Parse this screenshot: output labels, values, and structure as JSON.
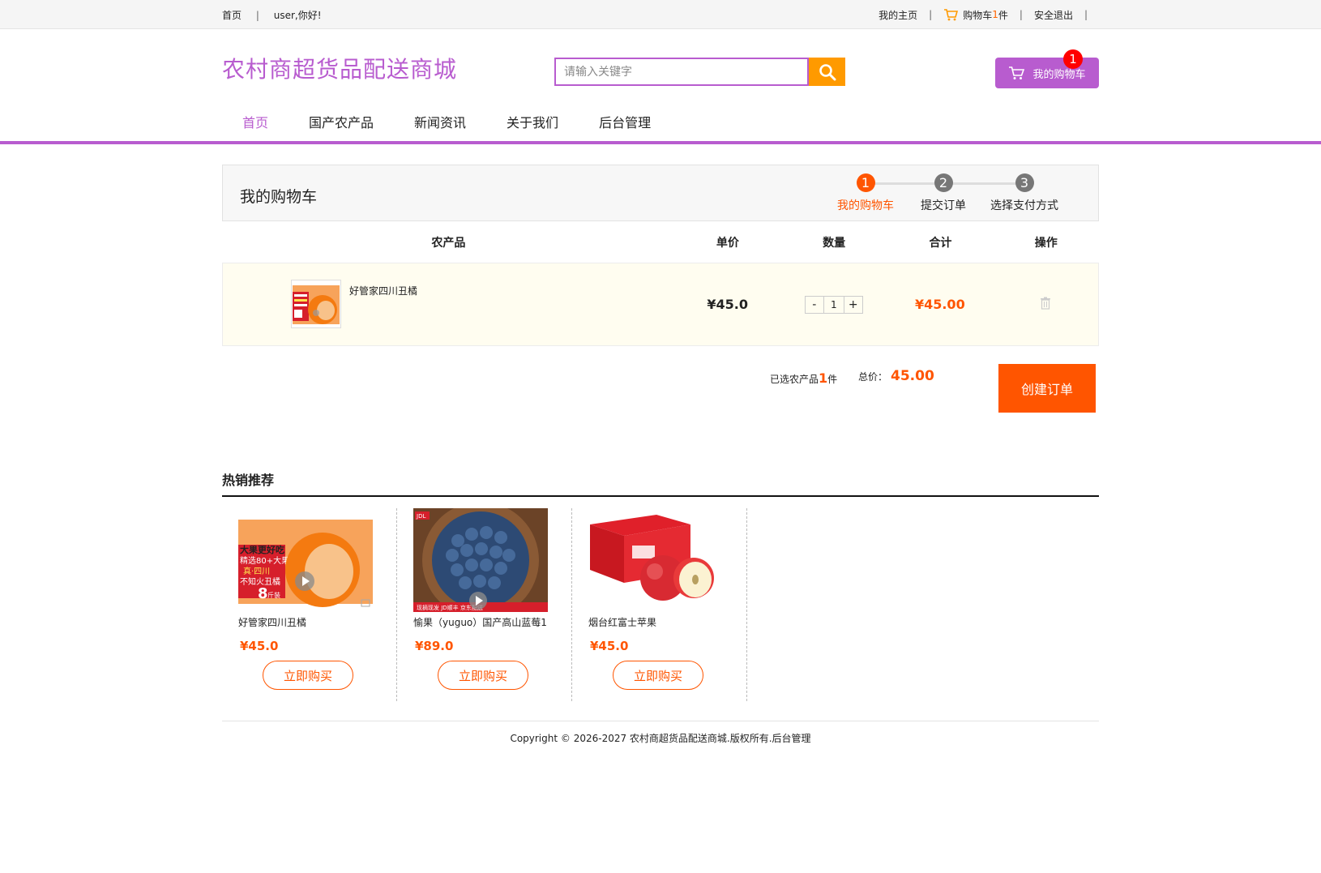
{
  "topbar": {
    "home": "首页",
    "separator": "|",
    "greeting": "user,你好!",
    "my_home": "我的主页",
    "cart_label": "购物车",
    "cart_count": "1",
    "cart_unit": "件",
    "logout": "安全退出"
  },
  "header": {
    "logo": "农村商超货品配送商城",
    "search_placeholder": "请输入关键字",
    "cart_button": "我的购物车",
    "cart_badge": "1"
  },
  "nav": {
    "items": [
      {
        "label": "首页",
        "active": true
      },
      {
        "label": "国产农产品",
        "active": false
      },
      {
        "label": "新闻资讯",
        "active": false
      },
      {
        "label": "关于我们",
        "active": false
      },
      {
        "label": "后台管理",
        "active": false
      }
    ]
  },
  "cart": {
    "title": "我的购物车",
    "steps": [
      {
        "num": "1",
        "label": "我的购物车",
        "active": true
      },
      {
        "num": "2",
        "label": "提交订单",
        "active": false
      },
      {
        "num": "3",
        "label": "选择支付方式",
        "active": false
      }
    ],
    "columns": {
      "product": "农产品",
      "price": "单价",
      "quantity": "数量",
      "total": "合计",
      "action": "操作"
    },
    "items": [
      {
        "name": "好管家四川丑橘",
        "price": "¥45.0",
        "qty_minus": "-",
        "qty": "1",
        "qty_plus": "+",
        "total": "¥45.00"
      }
    ],
    "summary": {
      "selected_prefix": "已选农产品",
      "selected_count": "1",
      "selected_suffix": "件",
      "total_label": "总价：",
      "total_value": "45.00",
      "create_order": "创建订单"
    }
  },
  "hot": {
    "title": "热销推荐",
    "items": [
      {
        "name": "好管家四川丑橘",
        "price": "¥45.0",
        "buy": "立即购买"
      },
      {
        "name": "愉果（yuguo）国产高山蓝莓1",
        "price": "¥89.0",
        "buy": "立即购买"
      },
      {
        "name": "烟台红富士苹果",
        "price": "¥45.0",
        "buy": "立即购买"
      }
    ],
    "image_texts": {
      "orange_banner_1": "大果更好吃",
      "orange_banner_2": "精选80+大果",
      "orange_banner_3": "真·四川",
      "orange_banner_4": "不知火丑橘",
      "orange_weight": "8",
      "orange_weight_unit": "斤装",
      "blueberry_brand": "JDL",
      "blueberry_strip": "现摘现发 JD顺丰 京东配送"
    }
  },
  "footer": {
    "copyright": "Copyright © 2026-2027 农村商超货品配送商城.版权所有.后台管理"
  },
  "colors": {
    "brand": "#b85ccf",
    "accent": "#ff5500",
    "search_button": "#ff9a00",
    "badge": "#ff0000"
  }
}
